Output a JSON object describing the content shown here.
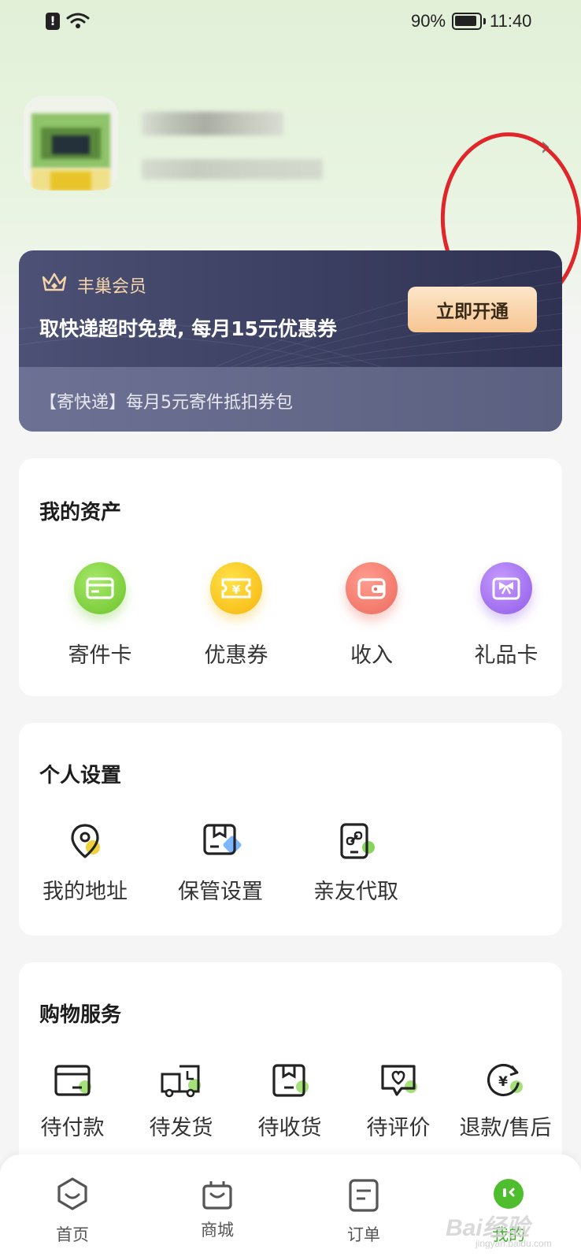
{
  "status_bar": {
    "battery_pct": "90%",
    "time": "11:40",
    "icons": [
      "alert-icon",
      "wifi-icon",
      "battery-icon"
    ]
  },
  "profile": {
    "arrow": "›"
  },
  "member": {
    "title": "丰巢会员",
    "desc": "取快递超时免费, 每月15元优惠券",
    "button": "立即开通",
    "bottom_text": "【寄快递】每月5元寄件抵扣券包"
  },
  "assets": {
    "title": "我的资产",
    "items": [
      {
        "label": "寄件卡",
        "icon": "card-icon",
        "color": "#7bd13a"
      },
      {
        "label": "优惠券",
        "icon": "coupon-icon",
        "color": "#f7c21e"
      },
      {
        "label": "收入",
        "icon": "wallet-icon",
        "color": "#f17b6e"
      },
      {
        "label": "礼品卡",
        "icon": "gift-icon",
        "color": "#a272ee"
      }
    ]
  },
  "settings": {
    "title": "个人设置",
    "items": [
      {
        "label": "我的地址",
        "icon": "location-pin-icon"
      },
      {
        "label": "保管设置",
        "icon": "storage-box-icon"
      },
      {
        "label": "亲友代取",
        "icon": "phone-link-icon"
      }
    ]
  },
  "shopping": {
    "title": "购物服务",
    "items": [
      {
        "label": "待付款",
        "icon": "wallet-card-icon"
      },
      {
        "label": "待发货",
        "icon": "truck-icon"
      },
      {
        "label": "待收货",
        "icon": "package-icon"
      },
      {
        "label": "待评价",
        "icon": "heart-chat-icon"
      },
      {
        "label": "退款/售后",
        "icon": "refund-icon"
      }
    ]
  },
  "nav": {
    "items": [
      {
        "label": "首页",
        "icon": "home-icon"
      },
      {
        "label": "商城",
        "icon": "shopping-bag-icon"
      },
      {
        "label": "订单",
        "icon": "order-icon"
      },
      {
        "label": "我的",
        "icon": "profile-icon"
      }
    ],
    "active": "我的"
  },
  "watermark": {
    "text": "Bai经验",
    "sub": "jingyan.baidu.com"
  },
  "colors": {
    "accent_green": "#3fae2b",
    "member_gold": "#f6d6a9",
    "highlight_red": "#e0262b"
  }
}
